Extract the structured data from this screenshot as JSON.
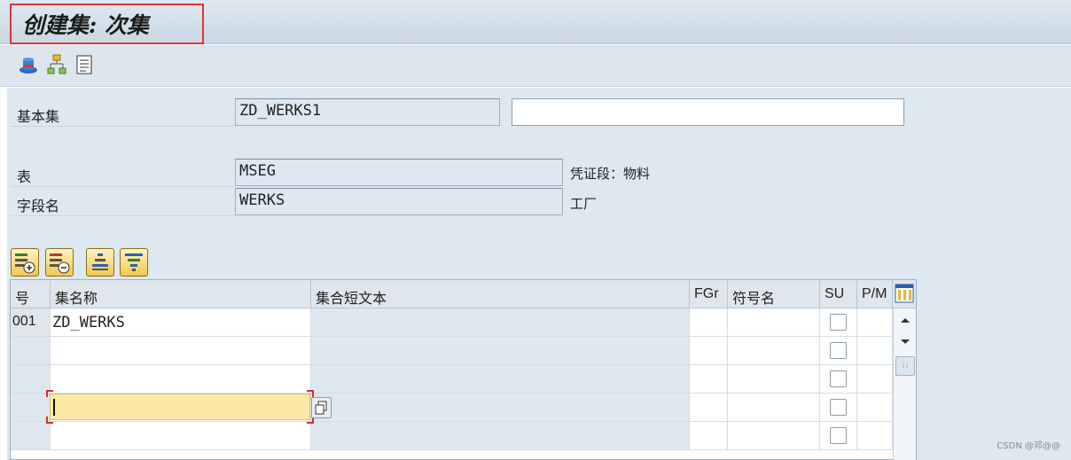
{
  "window": {
    "title": "创建集: 次集"
  },
  "toolbar": {
    "icons": [
      "hat-icon",
      "hierarchy-icon",
      "document-list-icon"
    ]
  },
  "form": {
    "basic_set_label": "基本集",
    "basic_set_value": "ZD_WERKS1",
    "basic_set_desc": "",
    "table_label": "表",
    "table_value": "MSEG",
    "table_desc": "凭证段：物料",
    "field_label": "字段名",
    "field_value": "WERKS",
    "field_desc": "工厂"
  },
  "grid": {
    "columns": {
      "num": "号",
      "set_name": "集名称",
      "set_short_text": "集合短文本",
      "fgr": "FGr",
      "symbol": "符号名",
      "su": "SU",
      "pm": "P/M"
    },
    "rows": [
      {
        "num": "001",
        "set_name": "ZD_WERKS",
        "short_text": "",
        "fgr": "",
        "symbol": "",
        "su": false,
        "pm": ""
      },
      {
        "num": "",
        "set_name": "",
        "short_text": "",
        "fgr": "",
        "symbol": "",
        "su": false,
        "pm": ""
      },
      {
        "num": "",
        "set_name": "",
        "short_text": "",
        "fgr": "",
        "symbol": "",
        "su": false,
        "pm": ""
      },
      {
        "num": "",
        "set_name": "",
        "short_text": "",
        "fgr": "",
        "symbol": "",
        "su": false,
        "pm": ""
      },
      {
        "num": "",
        "set_name": "",
        "short_text": "",
        "fgr": "",
        "symbol": "",
        "su": false,
        "pm": ""
      }
    ]
  },
  "watermark": "CSDN @邓@@",
  "colors": {
    "accent_red": "#e0333a",
    "active_cell": "#fde9a6",
    "bg": "#dde8f1"
  }
}
